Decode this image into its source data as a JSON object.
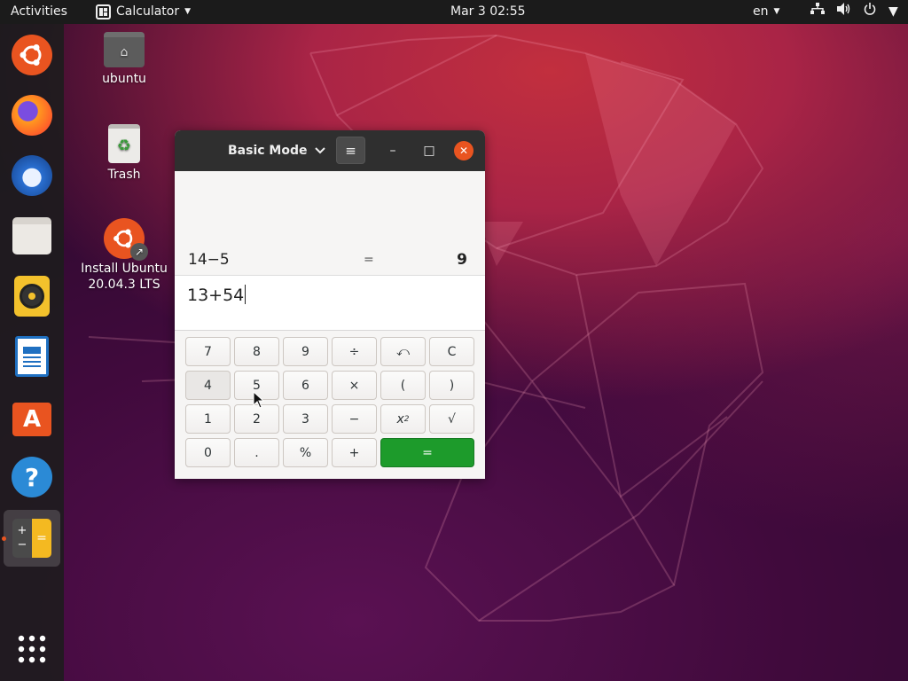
{
  "topbar": {
    "activities": "Activities",
    "app_name": "Calculator",
    "clock": "Mar 3  02:55",
    "language": "en"
  },
  "dock": {
    "items": [
      "ubuntu-software-launcher",
      "firefox",
      "thunderbird",
      "files",
      "rhythmbox",
      "libreoffice-writer",
      "ubuntu-software",
      "help",
      "calculator",
      "show-applications"
    ],
    "active": "calculator"
  },
  "desktop": {
    "home_label": "ubuntu",
    "trash_label": "Trash",
    "install_label_line1": "Install Ubuntu",
    "install_label_line2": "20.04.3 LTS"
  },
  "calculator": {
    "mode_label": "Basic Mode",
    "menu_icon": "≡",
    "minimize": "–",
    "maximize": "□",
    "close": "✕",
    "history": {
      "expression": "14−5",
      "equals": "=",
      "result": "9"
    },
    "entry": "13+54",
    "keys": {
      "k7": "7",
      "k8": "8",
      "k9": "9",
      "divide": "÷",
      "undo": "⤺",
      "clear": "C",
      "k4": "4",
      "k5": "5",
      "k6": "6",
      "multiply": "×",
      "lparen": "(",
      "rparen": ")",
      "k1": "1",
      "k2": "2",
      "k3": "3",
      "minus": "−",
      "square_base": "x",
      "square_exp": "2",
      "sqrt": "√",
      "k0": "0",
      "point": ".",
      "percent": "%",
      "plus": "+",
      "equals": "="
    }
  },
  "colors": {
    "accent": "#e95420",
    "equals_button": "#1d9b2b",
    "headerbar": "#2f2f2f",
    "topbar": "#1b1b1b"
  }
}
